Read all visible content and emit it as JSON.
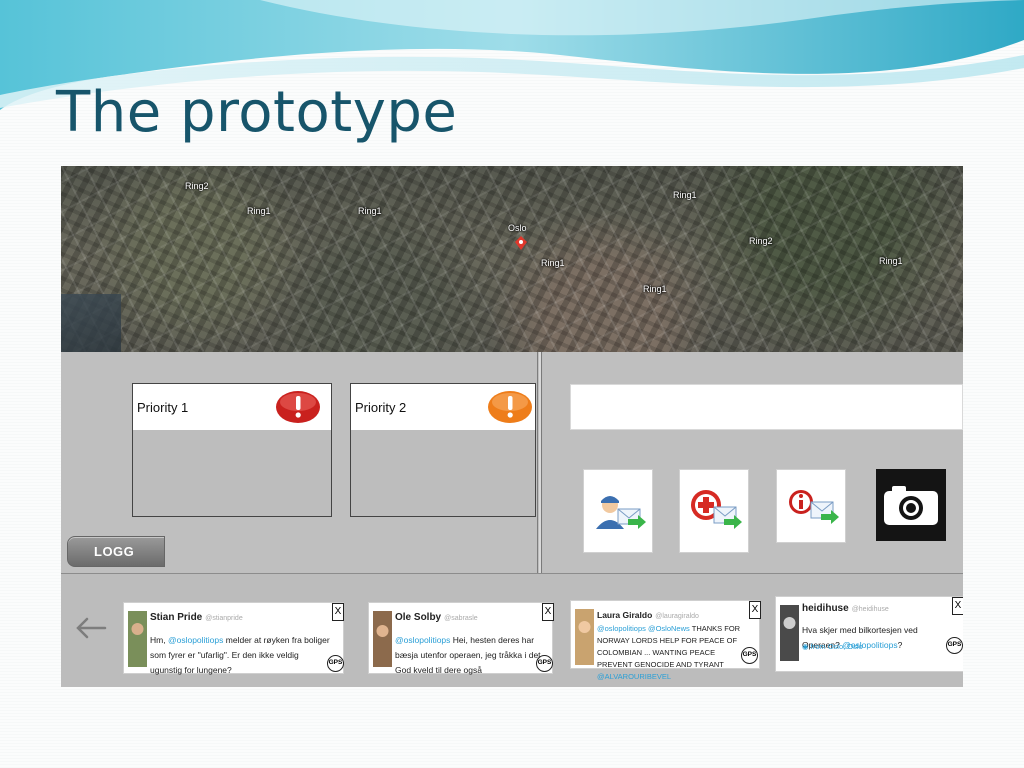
{
  "slide": {
    "title": "The prototype"
  },
  "map": {
    "labels": [
      "Oslo",
      "Ring1",
      "Ring1",
      "Ring1",
      "Ring1",
      "Ring1",
      "Ring2",
      "Ring2",
      "Ring1"
    ]
  },
  "priorities": [
    {
      "label": "Priority 1",
      "color": "#c9211e"
    },
    {
      "label": "Priority 2",
      "color": "#ee7d1a"
    }
  ],
  "buttons": {
    "logg": "LOGG"
  },
  "message_input": {
    "value": ""
  },
  "tweets": [
    {
      "name": "Stian Pride",
      "handle": "@stianpride",
      "mention": "@oslopolitiops",
      "text_prefix": "Hm,",
      "text": "melder at røyken fra boliger som fyrer er \"ufarlig\". Er den ikke veldig ugunstig for lungene?",
      "close": "X",
      "gps": "GPS"
    },
    {
      "name": "Ole Solby",
      "handle": "@sabrasle",
      "mention": "@oslopolitiops",
      "text": "Hei, hesten deres har bæsja utenfor operaen, jeg tråkka i det. God kveld til dere også",
      "close": "X",
      "gps": "GPS"
    },
    {
      "name": "Laura Giraldo",
      "handle": "@lauragiraldo",
      "mentions": [
        "@oslopolitiops",
        "@OsloNews"
      ],
      "text": "THANKS FOR NORWAY LORDS HELP FOR PEACE OF COLOMBIAN ... WANTING PEACE PREVENT GENOCIDE AND TYRANT",
      "mention_end": "@ALVAROURIBEVEL",
      "close": "X",
      "gps": "GPS"
    },
    {
      "name": "heidihuse",
      "handle": "@heidihuse",
      "text": "Hva skjer med bilkortesjen ved Operaen?",
      "mention": "@oslopolitiops",
      "text_suffix": "?",
      "location": "from Oslo, Oslo",
      "close": "X",
      "gps": "GPS"
    }
  ]
}
